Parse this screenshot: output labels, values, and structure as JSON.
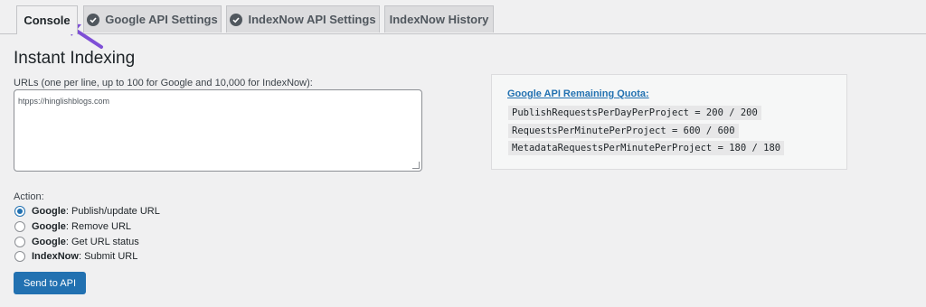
{
  "tabs": [
    {
      "label": "Console",
      "active": true,
      "icon": ""
    },
    {
      "label": "Google API Settings",
      "active": false,
      "icon": "check-circle-icon"
    },
    {
      "label": "IndexNow API Settings",
      "active": false,
      "icon": "check-circle-icon"
    },
    {
      "label": "IndexNow History",
      "active": false,
      "icon": ""
    }
  ],
  "page_title": "Instant Indexing",
  "urls": {
    "label": "URLs (one per line, up to 100 for Google and 10,000 for IndexNow):",
    "value": "htpps://hinglishblogs.com"
  },
  "quota": {
    "title": "Google API Remaining Quota:",
    "lines": [
      "PublishRequestsPerDayPerProject = 200 / 200",
      "RequestsPerMinutePerProject = 600 / 600",
      "MetadataRequestsPerMinutePerProject = 180 / 180"
    ]
  },
  "action": {
    "label": "Action:",
    "options": [
      {
        "service": "Google",
        "text": ": Publish/update URL",
        "checked": true
      },
      {
        "service": "Google",
        "text": ": Remove URL",
        "checked": false
      },
      {
        "service": "Google",
        "text": ": Get URL status",
        "checked": false
      },
      {
        "service": "IndexNow",
        "text": ": Submit URL",
        "checked": false
      }
    ]
  },
  "send_button": "Send to API",
  "colors": {
    "accent": "#2271b1",
    "annotation_arrow": "#7e4fd6"
  }
}
